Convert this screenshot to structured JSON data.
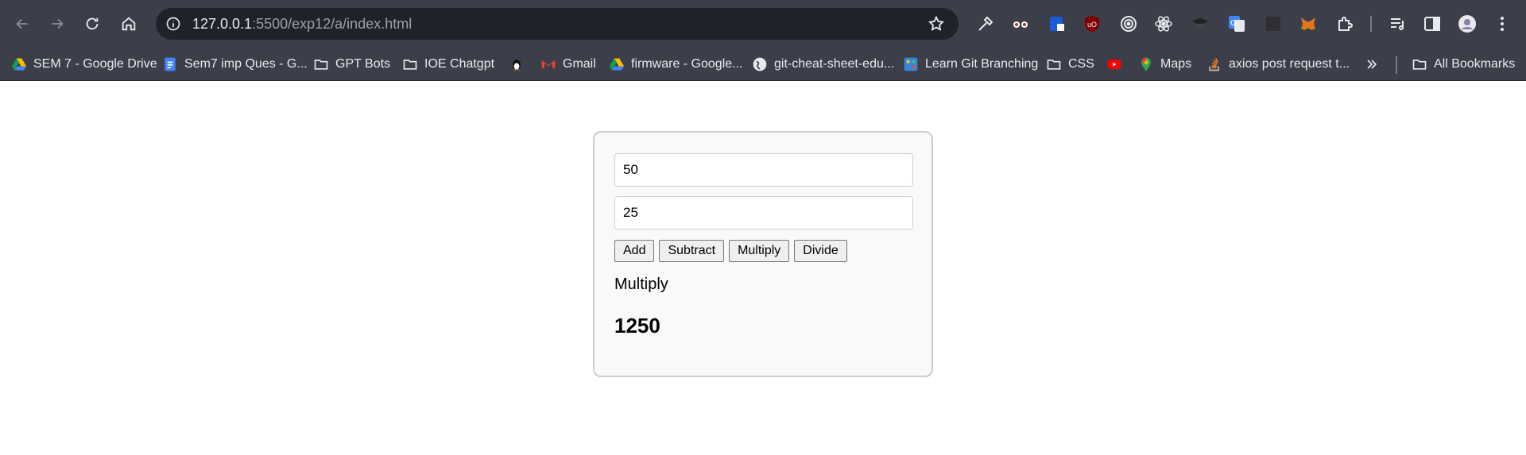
{
  "browser": {
    "url_host": "127.0.0.1",
    "url_rest": ":5500/exp12/a/index.html"
  },
  "bookmarks": [
    {
      "label": "SEM 7 - Google Drive",
      "icon": "google-drive-icon"
    },
    {
      "label": "Sem7 imp Ques - G...",
      "icon": "google-docs-icon"
    },
    {
      "label": "GPT Bots",
      "icon": "folder-icon"
    },
    {
      "label": "IOE Chatgpt",
      "icon": "folder-icon"
    },
    {
      "label": "",
      "icon": "linux-penguin-icon"
    },
    {
      "label": "Gmail",
      "icon": "gmail-icon"
    },
    {
      "label": "firmware - Google...",
      "icon": "google-drive-icon"
    },
    {
      "label": "git-cheat-sheet-edu...",
      "icon": "globe-icon"
    },
    {
      "label": "Learn Git Branching",
      "icon": "git-branching-icon"
    },
    {
      "label": "CSS",
      "icon": "folder-icon"
    },
    {
      "label": "",
      "icon": "youtube-icon"
    },
    {
      "label": "Maps",
      "icon": "maps-icon"
    },
    {
      "label": "axios post request t...",
      "icon": "stackoverflow-icon"
    },
    {
      "label": "All Bookmarks",
      "icon": "folder-icon"
    }
  ],
  "calculator": {
    "input1_value": "50",
    "input2_value": "25",
    "buttons": {
      "add": "Add",
      "subtract": "Subtract",
      "multiply": "Multiply",
      "divide": "Divide"
    },
    "operation": "Multiply",
    "result": "1250"
  }
}
